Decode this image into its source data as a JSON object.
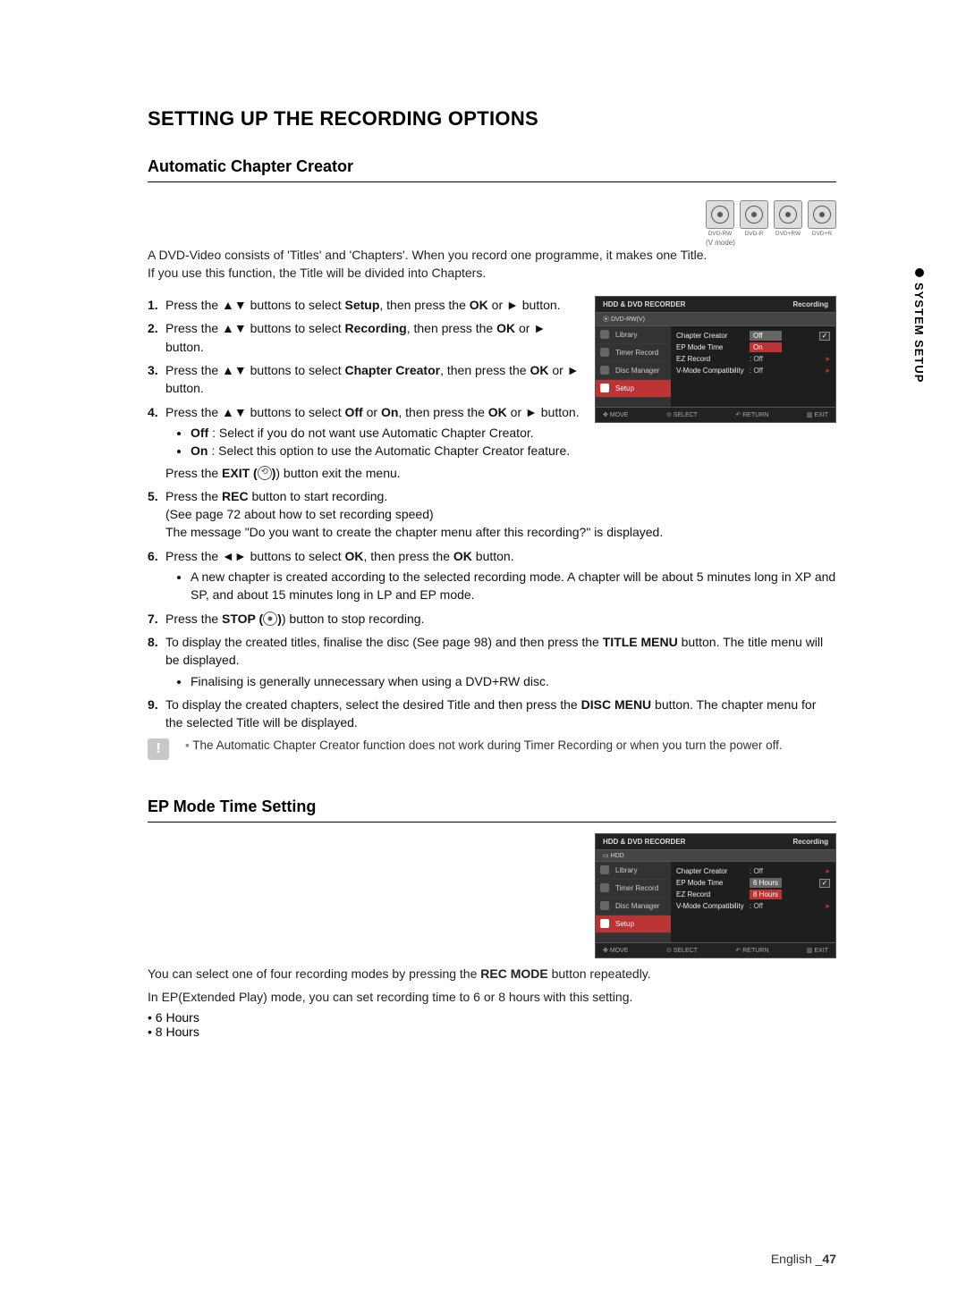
{
  "page": {
    "title": "SETTING UP THE RECORDING OPTIONS",
    "sidebar": "SYSTEM SETUP",
    "footer_lang": "English _",
    "footer_page": "47"
  },
  "s1": {
    "heading": "Automatic Chapter Creator",
    "formats": [
      "DVD-RW",
      "DVD-R",
      "DVD+RW",
      "DVD+R"
    ],
    "vmode": "(V mode)",
    "intro1": "A DVD-Video consists of 'Titles' and 'Chapters'. When you record one programme, it makes one Title.",
    "intro2": "If you use this function, the Title will be divided into Chapters.",
    "step1a": "Press the ▲▼ buttons to select ",
    "w_setup": "Setup",
    "step1b": ", then press the ",
    "w_ok": "OK",
    "step1c": " or ► button.",
    "step2a": "Press the ▲▼ buttons to select ",
    "w_recording": "Recording",
    "step2b": ", then press the ",
    "step2c": " or ► button.",
    "step3a": "Press the ▲▼ buttons to select ",
    "w_chcreator": "Chapter Creator",
    "step3b": ", then press the ",
    "step3c": " or ► button.",
    "step4a": "Press the ▲▼ buttons to select ",
    "w_off": "Off",
    "w_or": " or ",
    "w_on": "On",
    "step4b": ", then press the ",
    "step4c": " or ► button.",
    "step4_off": " : Select if you do not want use Automatic Chapter Creator.",
    "step4_on": " : Select this option to use the Automatic Chapter Creator feature.",
    "step4_exit_a": "Press the ",
    "w_exit": "EXIT (",
    "step4_exit_b": ") button exit the menu.",
    "step5a": "Press the ",
    "w_rec": "REC",
    "step5b": " button to start recording.",
    "step5c": "(See page 72 about how to set recording speed)",
    "step5d": "The message \"Do you want to create the chapter menu after this recording?\" is displayed.",
    "step6a": "Press the ◄► buttons to select ",
    "step6b": ", then press the ",
    "step6c": " button.",
    "step6_bullet": "A new chapter is created according to the selected recording mode. A chapter will be about 5 minutes long in XP and SP, and about 15 minutes long in LP and EP mode.",
    "step7a": "Press the ",
    "w_stop": "STOP (",
    "step7b": ") button to stop recording.",
    "step8a": "To display the created titles, finalise the disc (See page 98) and then press the ",
    "w_titlemenu": "TITLE MENU",
    "step8b": " button. The title menu will be displayed.",
    "step8_bullet": "Finalising is generally unnecessary when using a DVD+RW disc.",
    "step9a": "To display the created chapters, select the desired Title and then press the ",
    "w_discmenu": "DISC MENU",
    "step9b": " button. The chapter menu for the selected Title will be displayed.",
    "note": "The Automatic Chapter Creator function does not work during Timer Recording or when you turn the power off."
  },
  "s2": {
    "heading": "EP Mode Time Setting",
    "p1a": "You can select one of four recording modes by pressing the ",
    "w_recmode": "REC MODE",
    "p1b": " button repeatedly.",
    "p2": "In EP(Extended Play) mode, you can set recording time to 6 or 8 hours with this setting.",
    "b1": "6 Hours",
    "b2": "8 Hours"
  },
  "osd": {
    "header_l": "HDD & DVD RECORDER",
    "header_r": "Recording",
    "nav": [
      "Library",
      "Timer Record",
      "Disc Manager",
      "Setup"
    ],
    "row_cc": "Chapter Creator",
    "row_ep": "EP Mode Time",
    "row_ez": "EZ Record",
    "row_vc": "V-Mode Compatibility",
    "off": "Off",
    "on": "On",
    "h6": "6 Hours",
    "h8": "8 Hours",
    "val_off": ": Off",
    "foot_move": "MOVE",
    "foot_select": "SELECT",
    "foot_return": "RETURN",
    "foot_exit": "EXIT",
    "sub1": "DVD-RW(V)",
    "sub2": "HDD"
  }
}
